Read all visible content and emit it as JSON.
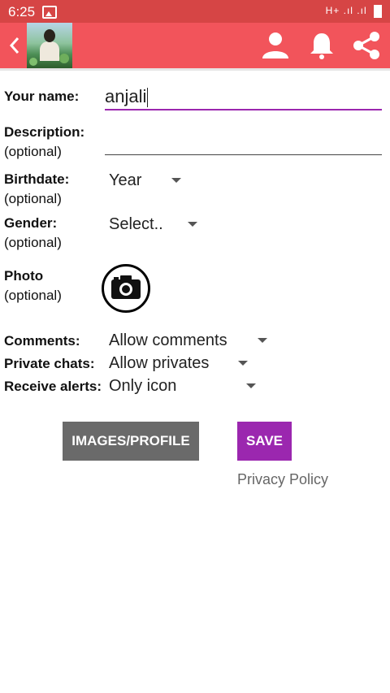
{
  "status_bar": {
    "time": "6:25",
    "network": "H+"
  },
  "app_bar": {
    "back_icon": "chevron-left-icon",
    "actions": [
      "person-icon",
      "bell-icon",
      "share-icon"
    ]
  },
  "form": {
    "name": {
      "label": "Your name:",
      "value": "anjali"
    },
    "description": {
      "label": "Description:",
      "optional": "(optional)",
      "value": ""
    },
    "birthdate": {
      "label": "Birthdate:",
      "optional": "(optional)",
      "value": "Year"
    },
    "gender": {
      "label": "Gender:",
      "optional": "(optional)",
      "value": "Select.."
    },
    "photo": {
      "label": "Photo",
      "optional": "(optional)",
      "icon": "camera-icon"
    },
    "comments": {
      "label": "Comments:",
      "value": "Allow comments"
    },
    "private_chats": {
      "label": "Private chats:",
      "value": "Allow privates"
    },
    "receive_alerts": {
      "label": "Receive alerts:",
      "value": "Only icon"
    }
  },
  "buttons": {
    "images_profile": "IMAGES/PROFILE",
    "save": "SAVE"
  },
  "links": {
    "privacy_policy": "Privacy Policy"
  },
  "colors": {
    "status_bar": "#d64545",
    "app_bar": "#f2545b",
    "accent": "#9b27af",
    "secondary_button": "#6a6a6a"
  }
}
